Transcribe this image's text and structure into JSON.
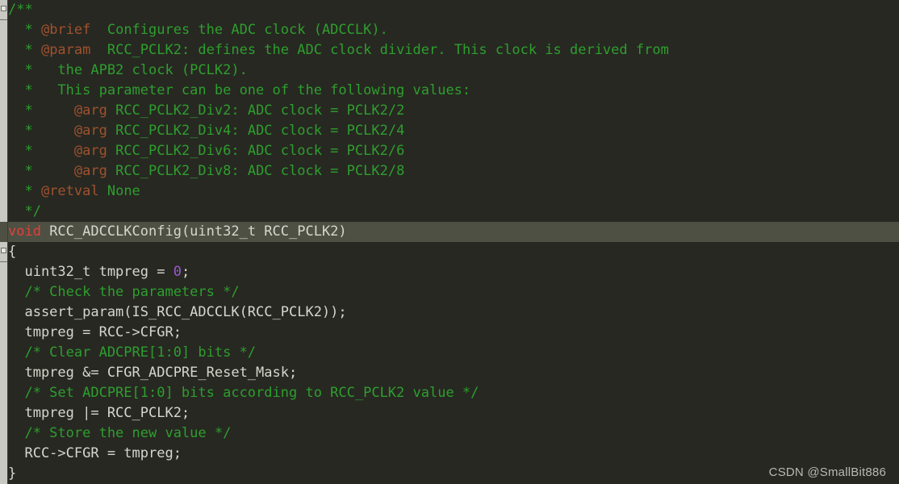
{
  "editor": {
    "background_color": "#272822",
    "current_line_color": "#4e5043",
    "gutter_color": "#c9c9c4",
    "font_size_px": 17,
    "line_height_px": 25
  },
  "colors": {
    "comment": "#2e9e2e",
    "doc_tag": "#a0522d",
    "keyword": "#e0403c",
    "identifier": "#d6d6ce",
    "number": "#9b59d0"
  },
  "watermark": {
    "text": "CSDN @SmallBit886"
  },
  "code": {
    "language": "c",
    "function_name": "RCC_ADCCLKConfig",
    "lines": [
      {
        "index": 1,
        "current": false,
        "fold_marker": true,
        "tokens": [
          {
            "text": "/**",
            "type": "comment"
          }
        ]
      },
      {
        "index": 2,
        "current": false,
        "fold_marker": false,
        "tokens": [
          {
            "text": "  * ",
            "type": "comment"
          },
          {
            "text": "@brief",
            "type": "doc_tag"
          },
          {
            "text": "  Configures the ADC clock (ADCCLK).",
            "type": "comment"
          }
        ]
      },
      {
        "index": 3,
        "current": false,
        "fold_marker": false,
        "tokens": [
          {
            "text": "  * ",
            "type": "comment"
          },
          {
            "text": "@param",
            "type": "doc_tag"
          },
          {
            "text": "  RCC_PCLK2: defines the ADC clock divider. This clock is derived from",
            "type": "comment"
          }
        ]
      },
      {
        "index": 4,
        "current": false,
        "fold_marker": false,
        "tokens": [
          {
            "text": "  *   the APB2 clock (PCLK2).",
            "type": "comment"
          }
        ]
      },
      {
        "index": 5,
        "current": false,
        "fold_marker": false,
        "tokens": [
          {
            "text": "  *   This parameter can be one of the following values:",
            "type": "comment"
          }
        ]
      },
      {
        "index": 6,
        "current": false,
        "fold_marker": false,
        "tokens": [
          {
            "text": "  *     ",
            "type": "comment"
          },
          {
            "text": "@arg",
            "type": "doc_tag"
          },
          {
            "text": " RCC_PCLK2_Div2: ADC clock = PCLK2/2",
            "type": "comment"
          }
        ]
      },
      {
        "index": 7,
        "current": false,
        "fold_marker": false,
        "tokens": [
          {
            "text": "  *     ",
            "type": "comment"
          },
          {
            "text": "@arg",
            "type": "doc_tag"
          },
          {
            "text": " RCC_PCLK2_Div4: ADC clock = PCLK2/4",
            "type": "comment"
          }
        ]
      },
      {
        "index": 8,
        "current": false,
        "fold_marker": false,
        "tokens": [
          {
            "text": "  *     ",
            "type": "comment"
          },
          {
            "text": "@arg",
            "type": "doc_tag"
          },
          {
            "text": " RCC_PCLK2_Div6: ADC clock = PCLK2/6",
            "type": "comment"
          }
        ]
      },
      {
        "index": 9,
        "current": false,
        "fold_marker": false,
        "tokens": [
          {
            "text": "  *     ",
            "type": "comment"
          },
          {
            "text": "@arg",
            "type": "doc_tag"
          },
          {
            "text": " RCC_PCLK2_Div8: ADC clock = PCLK2/8",
            "type": "comment"
          }
        ]
      },
      {
        "index": 10,
        "current": false,
        "fold_marker": false,
        "tokens": [
          {
            "text": "  * ",
            "type": "comment"
          },
          {
            "text": "@retval",
            "type": "doc_tag"
          },
          {
            "text": " None",
            "type": "comment"
          }
        ]
      },
      {
        "index": 11,
        "current": false,
        "fold_marker": false,
        "tokens": [
          {
            "text": "  */",
            "type": "comment"
          }
        ]
      },
      {
        "index": 12,
        "current": true,
        "fold_marker": false,
        "tokens": [
          {
            "text": "void",
            "type": "keyword"
          },
          {
            "text": " RCC_ADCCLKConfig(uint32_t RCC_PCLK2)",
            "type": "identifier"
          }
        ]
      },
      {
        "index": 13,
        "current": false,
        "fold_marker": true,
        "tokens": [
          {
            "text": "{",
            "type": "identifier"
          }
        ]
      },
      {
        "index": 14,
        "current": false,
        "fold_marker": false,
        "tokens": [
          {
            "text": "  uint32_t tmpreg = ",
            "type": "identifier"
          },
          {
            "text": "0",
            "type": "number"
          },
          {
            "text": ";",
            "type": "identifier"
          }
        ]
      },
      {
        "index": 15,
        "current": false,
        "fold_marker": false,
        "tokens": [
          {
            "text": "  /* Check the parameters */",
            "type": "comment"
          }
        ]
      },
      {
        "index": 16,
        "current": false,
        "fold_marker": false,
        "tokens": [
          {
            "text": "  assert_param(IS_RCC_ADCCLK(RCC_PCLK2));",
            "type": "identifier"
          }
        ]
      },
      {
        "index": 17,
        "current": false,
        "fold_marker": false,
        "tokens": [
          {
            "text": "  tmpreg = RCC->CFGR;",
            "type": "identifier"
          }
        ]
      },
      {
        "index": 18,
        "current": false,
        "fold_marker": false,
        "tokens": [
          {
            "text": "  /* Clear ADCPRE[1:0] bits */",
            "type": "comment"
          }
        ]
      },
      {
        "index": 19,
        "current": false,
        "fold_marker": false,
        "tokens": [
          {
            "text": "  tmpreg &= CFGR_ADCPRE_Reset_Mask;",
            "type": "identifier"
          }
        ]
      },
      {
        "index": 20,
        "current": false,
        "fold_marker": false,
        "tokens": [
          {
            "text": "  /* Set ADCPRE[1:0] bits according to RCC_PCLK2 value */",
            "type": "comment"
          }
        ]
      },
      {
        "index": 21,
        "current": false,
        "fold_marker": false,
        "tokens": [
          {
            "text": "  tmpreg |= RCC_PCLK2;",
            "type": "identifier"
          }
        ]
      },
      {
        "index": 22,
        "current": false,
        "fold_marker": false,
        "tokens": [
          {
            "text": "  /* Store the new value */",
            "type": "comment"
          }
        ]
      },
      {
        "index": 23,
        "current": false,
        "fold_marker": false,
        "tokens": [
          {
            "text": "  RCC->CFGR = tmpreg;",
            "type": "identifier"
          }
        ]
      },
      {
        "index": 24,
        "current": false,
        "fold_marker": false,
        "tokens": [
          {
            "text": "}",
            "type": "identifier"
          }
        ]
      }
    ]
  }
}
